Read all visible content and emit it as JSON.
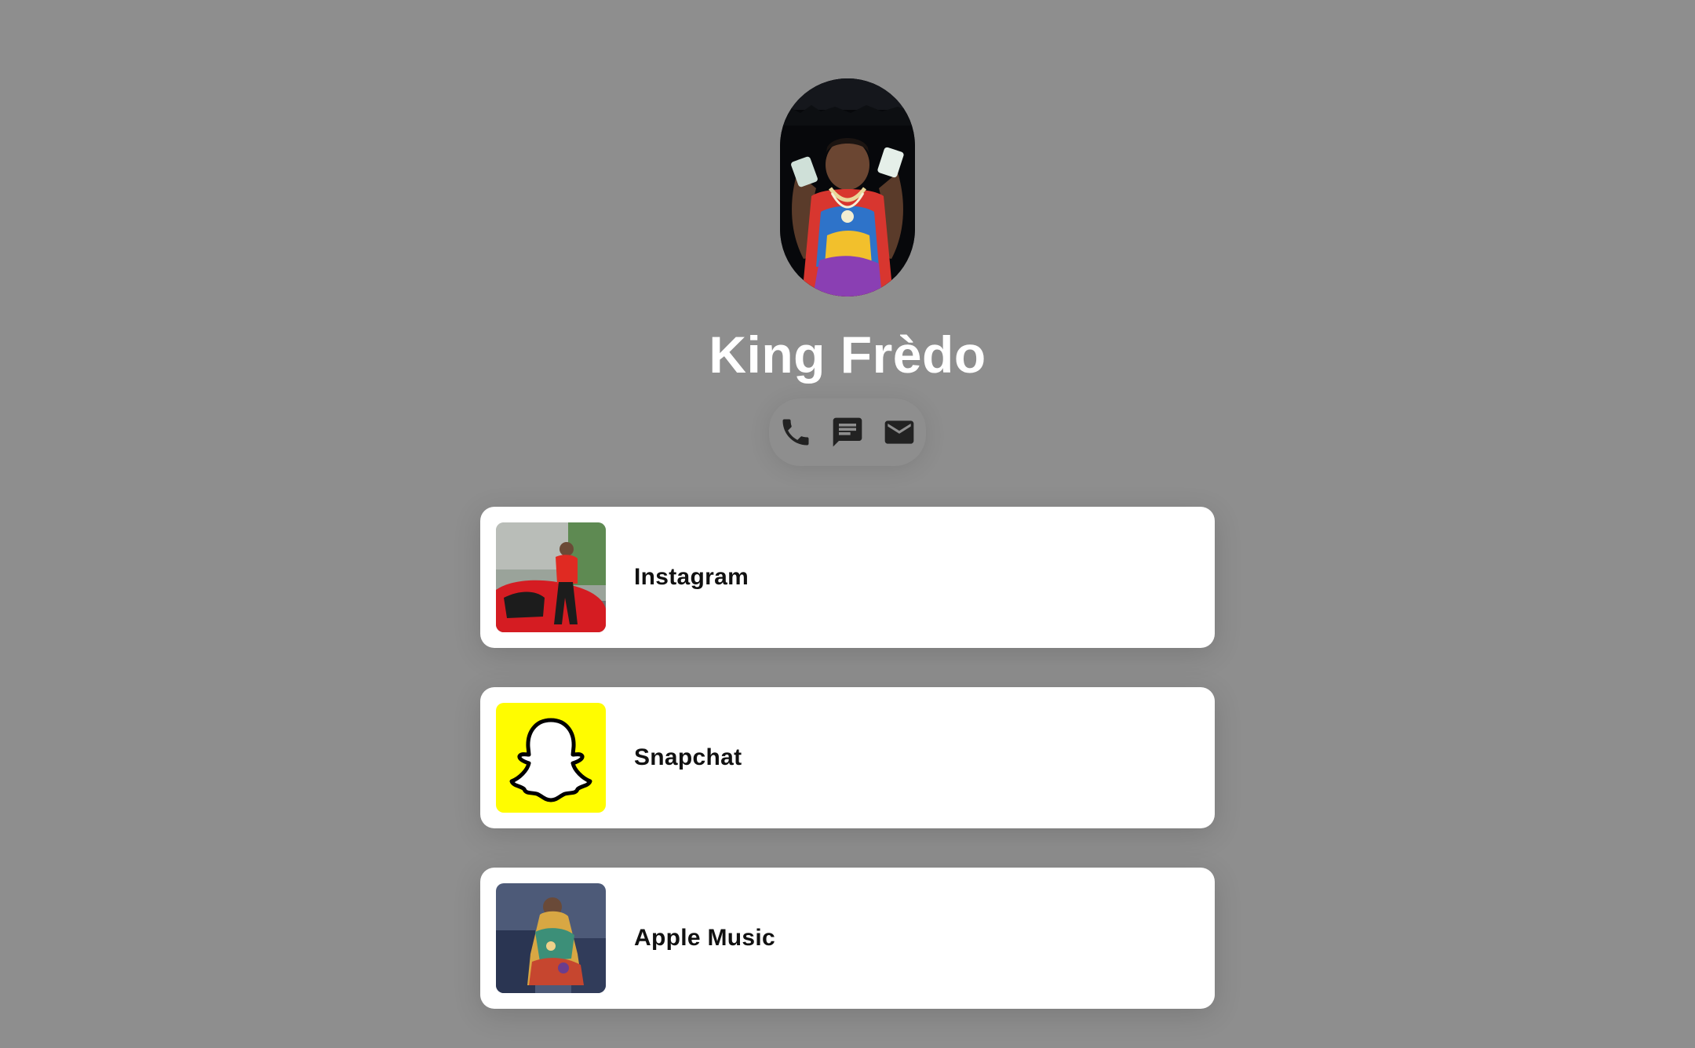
{
  "profile": {
    "name": "King Frèdo",
    "avatar_icon": "profile-photo"
  },
  "contact_icons": [
    {
      "name": "phone-icon",
      "label": "phone"
    },
    {
      "name": "message-icon",
      "label": "message"
    },
    {
      "name": "email-icon",
      "label": "email"
    }
  ],
  "links": [
    {
      "label": "Instagram",
      "thumb": "instagram-thumbnail"
    },
    {
      "label": "Snapchat",
      "thumb": "snapchat-ghost-logo"
    },
    {
      "label": "Apple Music",
      "thumb": "apple-music-thumbnail"
    }
  ],
  "colors": {
    "background": "#8e8e8e",
    "card": "#ffffff",
    "name_text": "#ffffff",
    "icon": "#222222",
    "snapchat_yellow": "#fffc00"
  }
}
